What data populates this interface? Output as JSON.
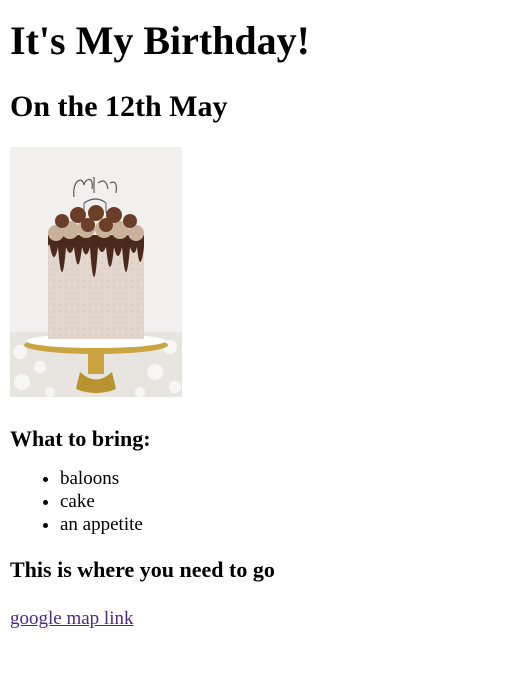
{
  "page": {
    "title": "It's My Birthday!",
    "subtitle": "On the 12th May",
    "bring_heading": "What to bring:",
    "bring_items": [
      "baloons",
      "cake",
      "an appetite"
    ],
    "where_heading": "This is where you need to go",
    "map_link_text": "google map link",
    "image_alt": "birthday cake",
    "colors": {
      "link": "#4b2a82",
      "text": "#000000",
      "background": "#ffffff"
    }
  }
}
